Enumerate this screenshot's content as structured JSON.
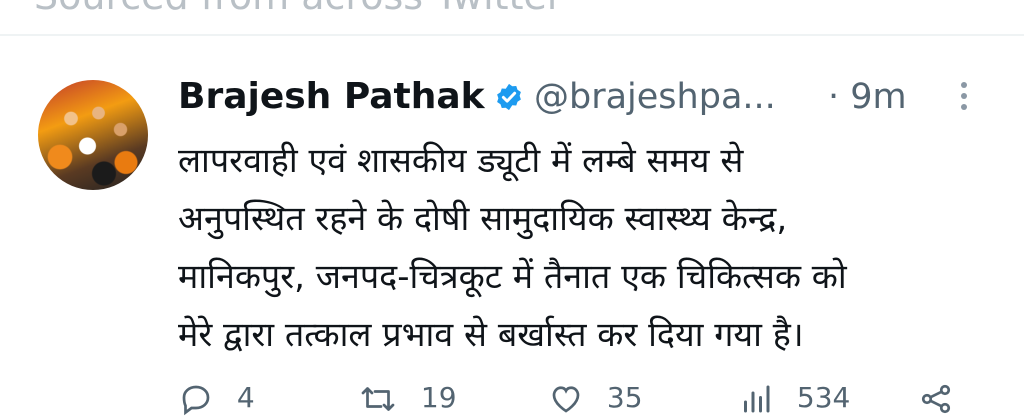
{
  "top_text": "Sourced from across Twitter",
  "tweet": {
    "author_name": "Brajesh Pathak",
    "handle": "@brajeshpa...",
    "time": "· 9m",
    "lines": [
      "लापरवाही एवं शासकीय ड्यूटी में लम्बे समय से",
      "अनुपस्थित रहने के दोषी सामुदायिक स्वास्थ्य केन्द्र,",
      "मानिकपुर, जनपद-चित्रकूट में तैनात एक चिकित्सक को",
      "मेरे द्वारा तत्काल प्रभाव से बर्खास्त कर दिया गया है।"
    ]
  },
  "actions": {
    "reply_count": "4",
    "retweet_count": "19",
    "like_count": "35",
    "views_count": "534"
  },
  "colors": {
    "verified": "#1d9bf0",
    "muted": "#536471",
    "text": "#0f1419"
  }
}
